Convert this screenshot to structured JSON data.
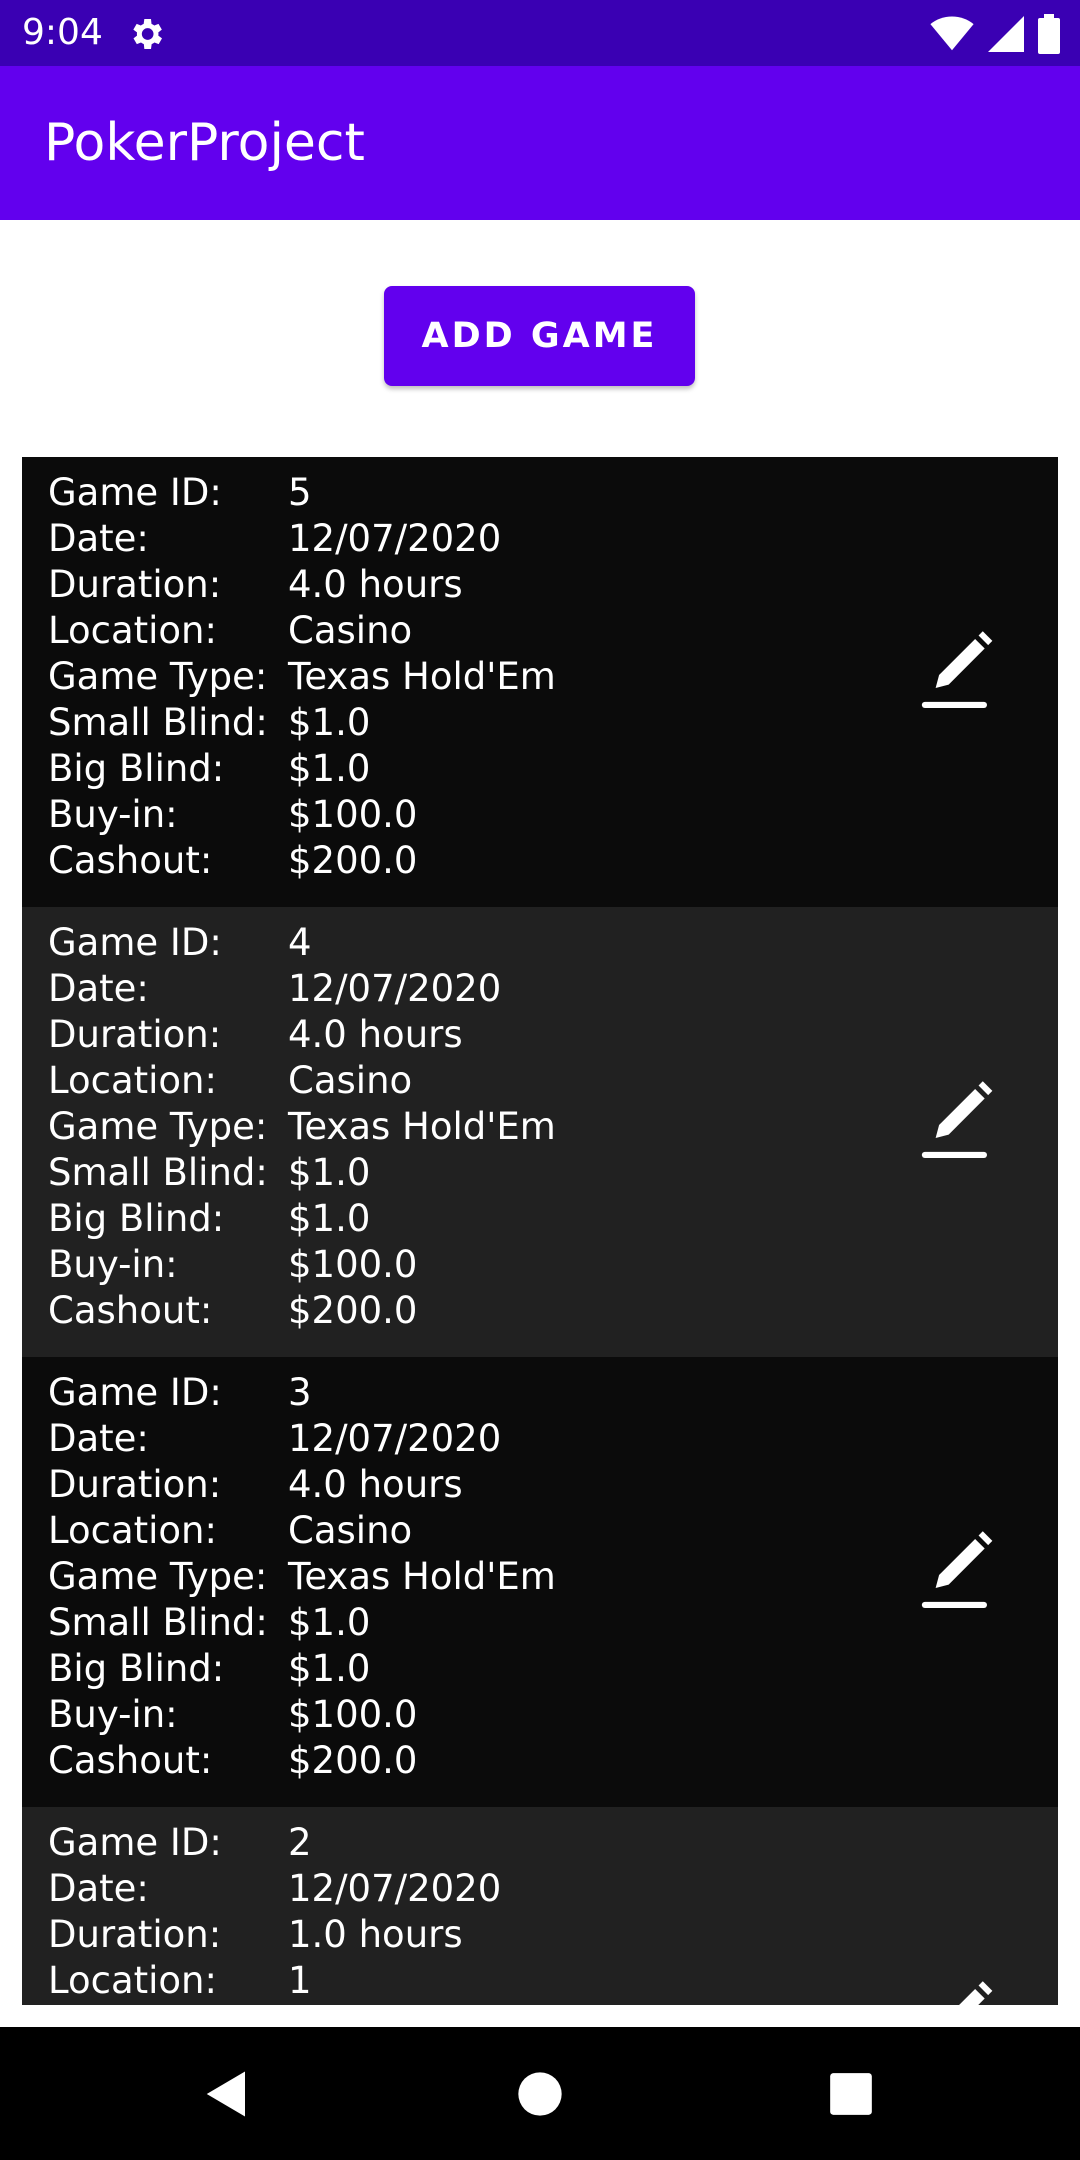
{
  "status_bar": {
    "time": "9:04",
    "icons": [
      "gear-icon",
      "wifi-icon",
      "signal-icon",
      "battery-icon"
    ]
  },
  "app_bar": {
    "title": "PokerProject"
  },
  "add_button": {
    "label": "ADD GAME"
  },
  "labels": {
    "game_id": "Game ID:",
    "date": "Date:",
    "duration": "Duration:",
    "location": "Location:",
    "game_type": "Game Type:",
    "small_blind": "Small Blind:",
    "big_blind": "Big Blind:",
    "buy_in": "Buy-in:",
    "cashout": "Cashout:"
  },
  "games": [
    {
      "game_id": "5",
      "date": "12/07/2020",
      "duration": "4.0 hours",
      "location": "Casino",
      "game_type": "Texas Hold'Em",
      "small_blind": "$1.0",
      "big_blind": "$1.0",
      "buy_in": "$100.0",
      "cashout": "$200.0"
    },
    {
      "game_id": "4",
      "date": "12/07/2020",
      "duration": "4.0 hours",
      "location": "Casino",
      "game_type": "Texas Hold'Em",
      "small_blind": "$1.0",
      "big_blind": "$1.0",
      "buy_in": "$100.0",
      "cashout": "$200.0"
    },
    {
      "game_id": "3",
      "date": "12/07/2020",
      "duration": "4.0 hours",
      "location": "Casino",
      "game_type": "Texas Hold'Em",
      "small_blind": "$1.0",
      "big_blind": "$1.0",
      "buy_in": "$100.0",
      "cashout": "$200.0"
    },
    {
      "game_id": "2",
      "date": "12/07/2020",
      "duration": "1.0 hours",
      "location": "1"
    }
  ],
  "colors": {
    "status_bar": "#3a00b3",
    "primary": "#6200ee",
    "card_dark": "#0b0b0b",
    "card_light": "#212121"
  }
}
